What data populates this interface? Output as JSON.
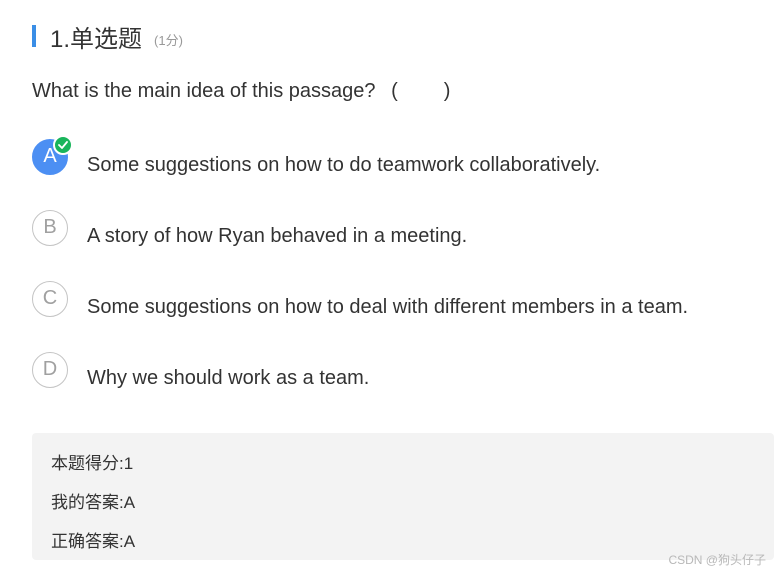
{
  "question": {
    "number_title": "1.单选题",
    "score_label": "(1分)",
    "stem": "What is the main idea of this passage?",
    "paren_open": "(",
    "paren_close": ")",
    "options": [
      {
        "letter": "A",
        "text": "Some suggestions on how to do teamwork collaboratively.",
        "selected": true,
        "correct": true
      },
      {
        "letter": "B",
        "text": "A story of how Ryan behaved in a meeting.",
        "selected": false
      },
      {
        "letter": "C",
        "text": "Some suggestions on how to deal with different members in a team.",
        "selected": false
      },
      {
        "letter": "D",
        "text": "Why we should work as a team.",
        "selected": false
      }
    ]
  },
  "result": {
    "score_label": "本题得分:",
    "score_value": "1",
    "my_answer_label": "我的答案:",
    "my_answer_value": "A",
    "correct_answer_label": "正确答案:",
    "correct_answer_value": "A"
  },
  "watermark": "CSDN @狗头仔子",
  "colors": {
    "accent": "#3a8ee6",
    "selected": "#4c8ff3",
    "correct_check": "#19b55b"
  }
}
